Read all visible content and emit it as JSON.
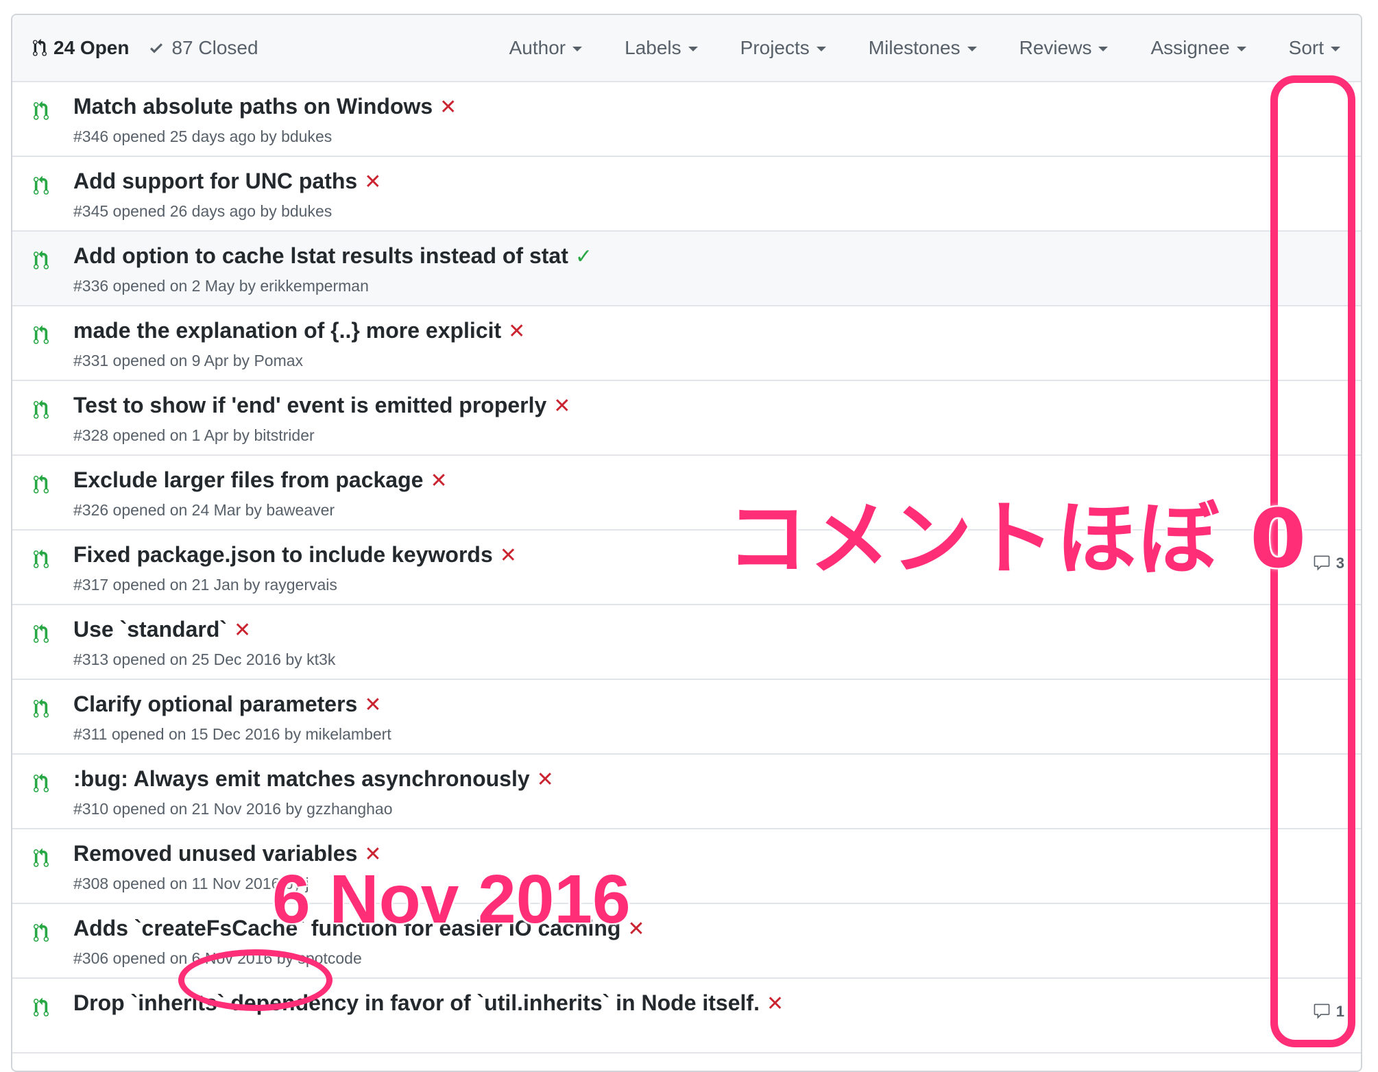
{
  "header": {
    "open_count": "24 Open",
    "closed_count": "87 Closed",
    "filters": [
      "Author",
      "Labels",
      "Projects",
      "Milestones",
      "Reviews",
      "Assignee",
      "Sort"
    ]
  },
  "pull_requests": [
    {
      "title": "Match absolute paths on Windows",
      "meta_prefix": "#346 opened 25 days ago by ",
      "author": "bdukes",
      "status": "fail",
      "status_glyph": "✕",
      "comments": ""
    },
    {
      "title": "Add support for UNC paths",
      "meta_prefix": "#345 opened 26 days ago by ",
      "author": "bdukes",
      "status": "fail",
      "status_glyph": "✕",
      "comments": ""
    },
    {
      "title": "Add option to cache lstat results instead of stat",
      "meta_prefix": "#336 opened on 2 May by ",
      "author": "erikkemperman",
      "status": "ok",
      "status_glyph": "✓",
      "comments": ""
    },
    {
      "title": "made the explanation of {..} more explicit",
      "meta_prefix": "#331 opened on 9 Apr by ",
      "author": "Pomax",
      "status": "fail",
      "status_glyph": "✕",
      "comments": ""
    },
    {
      "title": "Test to show if 'end' event is emitted properly",
      "meta_prefix": "#328 opened on 1 Apr by ",
      "author": "bitstrider",
      "status": "fail",
      "status_glyph": "✕",
      "comments": ""
    },
    {
      "title": "Exclude larger files from package",
      "meta_prefix": "#326 opened on 24 Mar by ",
      "author": "baweaver",
      "status": "fail",
      "status_glyph": "✕",
      "comments": ""
    },
    {
      "title": "Fixed package.json to include keywords",
      "meta_prefix": "#317 opened on 21 Jan by ",
      "author": "raygervais",
      "status": "fail",
      "status_glyph": "✕",
      "comments": "3"
    },
    {
      "title": "Use `standard`",
      "meta_prefix": "#313 opened on 25 Dec 2016 by ",
      "author": "kt3k",
      "status": "fail",
      "status_glyph": "✕",
      "comments": ""
    },
    {
      "title": "Clarify optional parameters",
      "meta_prefix": "#311 opened on 15 Dec 2016 by ",
      "author": "mikelambert",
      "status": "fail",
      "status_glyph": "✕",
      "comments": ""
    },
    {
      "title": ":bug: Always emit matches asynchronously",
      "meta_prefix": "#310 opened on 21 Nov 2016 by ",
      "author": "gzzhanghao",
      "status": "fail",
      "status_glyph": "✕",
      "comments": ""
    },
    {
      "title": "Removed unused variables",
      "meta_prefix": "#308 opened on 11 Nov 2016 by ",
      "author": "j",
      "status": "fail",
      "status_glyph": "✕",
      "comments": ""
    },
    {
      "title": "Adds `createFsCache` function for easier IO caching",
      "meta_prefix": "#306 opened on 6 Nov 2016 by ",
      "author": "spotcode",
      "status": "fail",
      "status_glyph": "✕",
      "comments": ""
    },
    {
      "title": "Drop `inherits` dependency in favor of `util.inherits` in Node itself.",
      "meta_prefix": "",
      "author": "",
      "status": "fail",
      "status_glyph": "✕",
      "comments": "1"
    }
  ],
  "annotations": {
    "comments_note": "コメントほぼ 0",
    "date_note": "6 Nov 2016",
    "highlight_color": "#ff2e76"
  },
  "icons": {
    "pr": "git-pull-request-icon",
    "comment": "comment-icon",
    "check": "check-icon",
    "fail": "x-icon"
  }
}
